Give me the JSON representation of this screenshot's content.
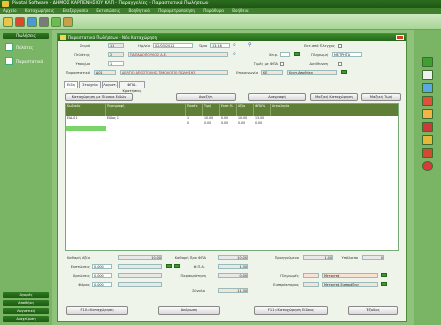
{
  "app": {
    "title": "Pivotal Software - ΔΗΜΟΣ ΚΑΡΠΕΝΗΣΙΟΥ ΚΛΠ - Παραγγελίες - Παραστατικά Πωλήσεων",
    "menu": [
      "Αρχείο",
      "Καταχωρήσεις",
      "Επεξεργασία",
      "Εκτυπώσεις",
      "Βοηθητικά",
      "Παραμετροποίηση",
      "Παράθυρα",
      "Βοήθεια"
    ]
  },
  "sidebar": {
    "header": "Πωλήσεις",
    "items": [
      {
        "label": "Πελάτες"
      },
      {
        "label": "Παραστατικά"
      }
    ],
    "bottom": [
      "Αγορές",
      "Αποθήκη",
      "Λογιστική",
      "Διαχείριση"
    ]
  },
  "window": {
    "title": "Παραστατικά Πωλήσεων - Νέα Καταχώρηση",
    "fields": {
      "series_label": "Σειρά",
      "series_value": "11",
      "date_label": "Ημ/νία",
      "date_value": "02/03/2012",
      "time_label": "Ώρα",
      "time_value": "13:16",
      "customer_label": "Πελάτης",
      "customer_code": "2",
      "customer_name": "ΠΑΠΑΔΟΠΟΥΛΟΣ Α.Ε.",
      "delivery_label": "Υποκ/μα",
      "delivery_value": "1",
      "doc_label": "Παραστατικό",
      "doc_code": "Δ01",
      "doc_name": "ΔΕΛΤΙΟ ΑΠΟΣΤΟΛΗΣ-ΤΙΜΟΛΟΓΙΟ ΠΩΛΗΣΗΣ",
      "excluded_label": "Εκτ.από Έλεγχος",
      "inventory_label": "Χειρ.",
      "vat_label": "Τιμές με ΦΠΑ",
      "address_label": "Διεύθυνση",
      "payment_label": "Πληρωμή",
      "payment_value": "ΜΕΤΡΗΤΑ",
      "warehouse_label": "Επικοινωνία",
      "warehouse_code": "ΚΕ",
      "warehouse_name": "Κεντ.Αποθήκη"
    },
    "tabs": [
      "Είδη",
      "Στοιχεία",
      "Λογιστ.",
      "ΦΠΑ-Κρατήσεις"
    ],
    "buttons": {
      "items_catalog": "Καταχώρηση με Πίνακα Ειδών",
      "search": "Αναζήτ.",
      "delete": "Διαγραφή",
      "bulk": "Μαζική Καταχώρηση",
      "cost": "Μαζική Τιμή",
      "f10": "F10=Καταχώρηση",
      "cancel": "Ακύρωση",
      "f11": "F11=Καταχώρηση Είδους",
      "exit": "Έξοδος"
    },
    "grid": {
      "columns": [
        "Κωδικός",
        "Περιγραφή",
        "Ποσότ.",
        "Τιμή",
        "Εκπτ.%",
        "Αξία",
        "ΦΠΑ%",
        "Αιτιολογία"
      ],
      "rows": [
        [
          "ΕΙΔ-01",
          "Είδος 1",
          "1",
          "10.00",
          "0.00",
          "10.00",
          "13.00",
          ""
        ],
        [
          "",
          "",
          "0",
          "0.00",
          "0.00",
          "0.00",
          "0.00",
          ""
        ]
      ]
    },
    "totals": {
      "net_label": "Καθαρή Αξία",
      "net_value": "10.00",
      "discount_label": "Εκπτώσεις",
      "discount_value": "0.000",
      "charges_label": "Χρεώσεις",
      "charges_value": "0.000",
      "vat_label": "Φόρος",
      "vat_value": "0.000",
      "taxable_label": "Καθαρή Προ ΦΠΑ",
      "taxable_value": "10.00",
      "vat_amount_label": "Φ.Π.Α.",
      "vat_amount_value": "1.30",
      "withheld_label": "Παρακράτηση",
      "withheld_value": "0.00",
      "total_label": "Σύνολο",
      "total_value": "11.30",
      "prev_label": "Προηγούμενο",
      "prev_value": "1.00",
      "balance_label": "Υπόλοιπο",
      "balance_value": "0",
      "payments_label": "Πληρωμές",
      "payments_value": "Μετρητά",
      "collector_label": "Εισπράκτορας",
      "collector_value": "Μετρητά Εισπράξεις"
    }
  }
}
